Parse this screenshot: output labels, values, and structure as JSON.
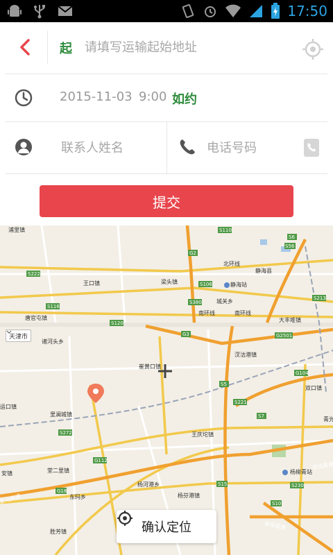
{
  "status_bar": {
    "time": "17:50",
    "icons": [
      "android-debug-icon",
      "usb-icon",
      "gmail-icon",
      "vibrate-icon",
      "alarm-icon",
      "wifi-icon",
      "signal-icon",
      "battery-charging-icon"
    ]
  },
  "form": {
    "start_marker": "起",
    "address_placeholder": "请填写运输起始地址",
    "address_value": "",
    "date": "2015-11-03",
    "time": "9:00",
    "on_time_label": "如约",
    "contact_name_placeholder": "联系人姓名",
    "phone_placeholder": "电话号码",
    "submit_label": "提交"
  },
  "map": {
    "city_selector": "天津市",
    "confirm_location_label": "确认定位",
    "labels": {
      "top": {
        "xi_gu_zhen": "浦里镇",
        "wang_kou_zhen": "王口镇",
        "liang_tou_zhen": "梁头镇",
        "jing_hai_zhan": "静海站",
        "jing_hai_xian": "静海县",
        "cheng_guan_xiang": "城关乡",
        "nan_huan_xian_1": "南环线",
        "nan_huan_xian_2": "南环线",
        "beihuan_xian": "北环线",
        "da_feng_dui_zhen": "大丰堆镇",
        "tang_guan_zhen": "唐官屯镇"
      },
      "bottom": {
        "tie_tou_xiang": "诸河头乡",
        "cao_jiacheng_zhen": "崔黄口镇",
        "li_wo_zhen": "汊沽港镇",
        "shuang_kou_zhen": "双口镇",
        "li_lan_cheng_zhen": "里澜城镇",
        "wang_qing_tuo_zhen": "王庆坨镇",
        "tong_er_li_zhen": "堂二里镇",
        "dong_lv_xiang": "东玛乡",
        "wu_he_gang_xiang": "杨河港乡",
        "jie_di_gang_zhen": "杨芬港镇",
        "yang_liu_qing_zhan": "杨柳青站",
        "sheng_fang_zhen": "胜芳镇",
        "an_zhen": "安镇",
        "zhou_kou_zhen": "运口镇",
        "qing_guang_zhen": "青光",
        "jin_bao_gao_su": "津保高速",
        "rong_wu_gao_su": "荣乌高速",
        "jin_yi_gao_su": "津沽高速"
      }
    },
    "road_shields": [
      "S110",
      "G2",
      "S6",
      "S56",
      "S222",
      "S116",
      "G104",
      "S380",
      "S106",
      "S213",
      "S120",
      "G3",
      "G2501",
      "G18",
      "S5",
      "S7",
      "S221",
      "S272",
      "G112",
      "S15",
      "S230",
      "S10"
    ]
  }
}
